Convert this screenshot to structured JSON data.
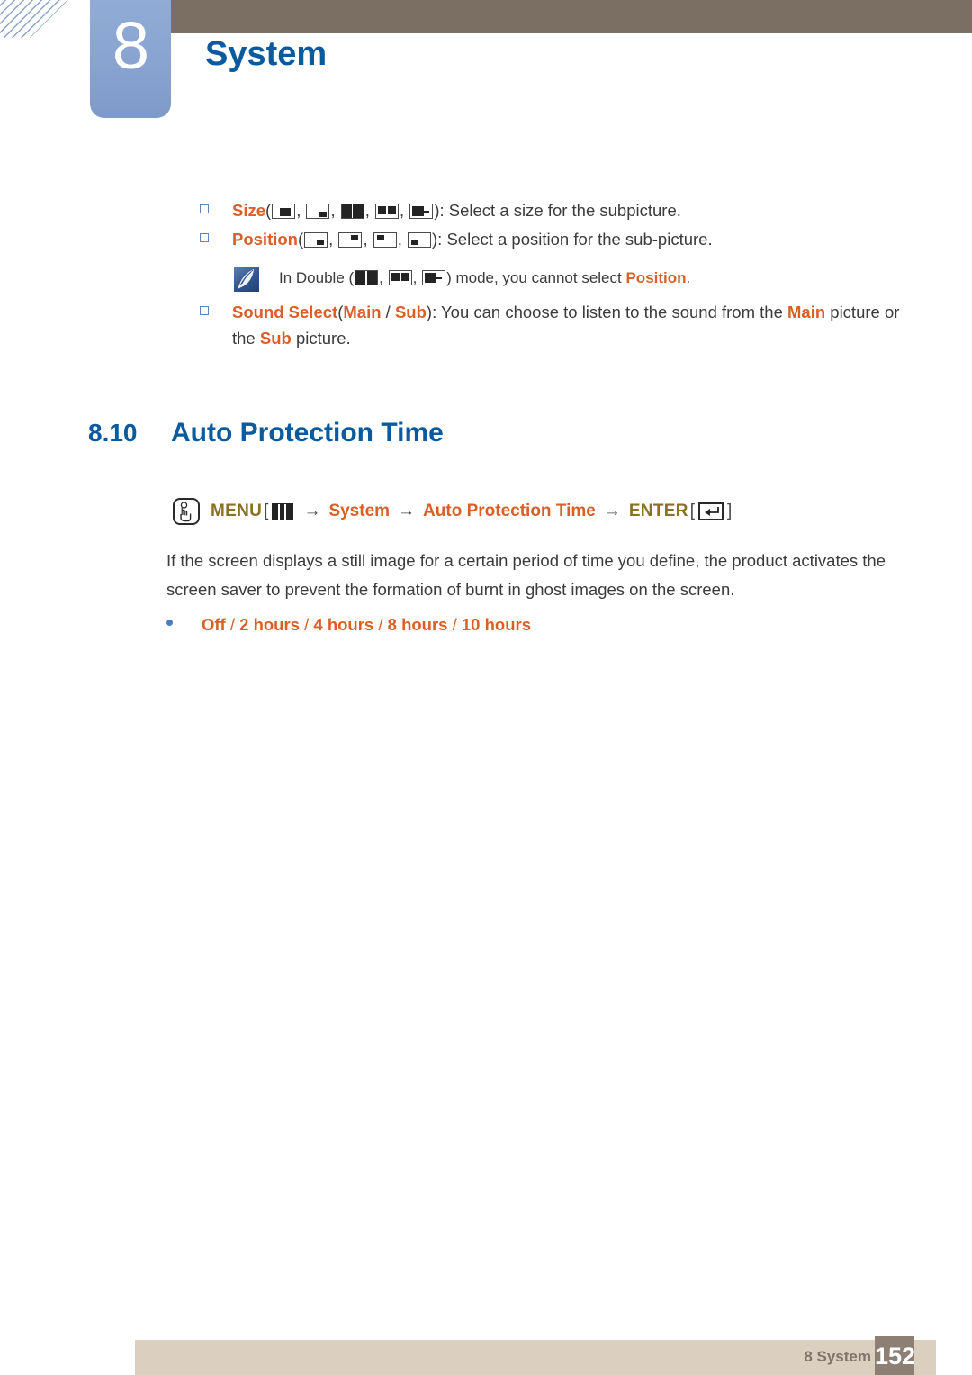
{
  "header": {
    "chapter_number": "8",
    "chapter_title": "System",
    "brown_bar_color": "#7b6e62",
    "tab_color": "#8aa5d2",
    "title_color": "#0a5aa0"
  },
  "pip_list": {
    "size_item": {
      "label": "Size",
      "open_paren": "(",
      "close_paren": ")",
      "separator": ", ",
      "icons": [
        "pip-size-large-sub",
        "pip-size-small-sub",
        "pip-double-split",
        "pip-double-boxes",
        "pip-double-wide"
      ],
      "description": ": Select a size for the subpicture."
    },
    "position_item": {
      "label": "Position",
      "open_paren": "(",
      "close_paren": ")",
      "separator": ", ",
      "icons": [
        "pip-pos-bottom-right",
        "pip-pos-top-right",
        "pip-pos-top-left",
        "pip-pos-bottom-left"
      ],
      "description": ": Select a position for the sub-picture."
    },
    "note": {
      "text_before": "In Double (",
      "icons": [
        "pip-double-split",
        "pip-double-boxes",
        "pip-double-wide"
      ],
      "separator": ", ",
      "text_after": ") mode, you cannot select ",
      "highlight": "Position",
      "text_end": "."
    },
    "sound_select_item": {
      "label": "Sound Select",
      "open_paren": "(",
      "option_main": "Main",
      "option_divider": " / ",
      "option_sub": "Sub",
      "close_paren": ")",
      "text_mid": ": You can choose to listen to the sound from the ",
      "main_word": "Main",
      "text_mid2": " picture or the ",
      "sub_word": "Sub",
      "text_end": " picture."
    }
  },
  "section": {
    "number": "8.10",
    "title": "Auto Protection Time"
  },
  "menu_path": {
    "hand_icon": "hand-press-icon",
    "menu_label": "MENU",
    "bracket_open": "[",
    "menu_icon": "menu-bars-icon",
    "bracket_close": "]",
    "arrow": "→",
    "step_system": "System",
    "step_auto_protection": "Auto Protection Time",
    "enter_label": "ENTER",
    "enter_icon": "enter-key-icon"
  },
  "body": {
    "paragraph": "If the screen displays a still image for a certain period of time you define, the product activates the screen saver to prevent the formation of burnt in ghost images on the screen."
  },
  "options": {
    "off": "Off",
    "sep": " / ",
    "two_hours": "2 hours",
    "four_hours": "4 hours",
    "eight_hours": "8 hours",
    "ten_hours": "10 hours"
  },
  "footer": {
    "label": "8 System",
    "page_number": "152",
    "bar_color": "#dbcfbf",
    "page_box_color": "#8d7f74"
  }
}
